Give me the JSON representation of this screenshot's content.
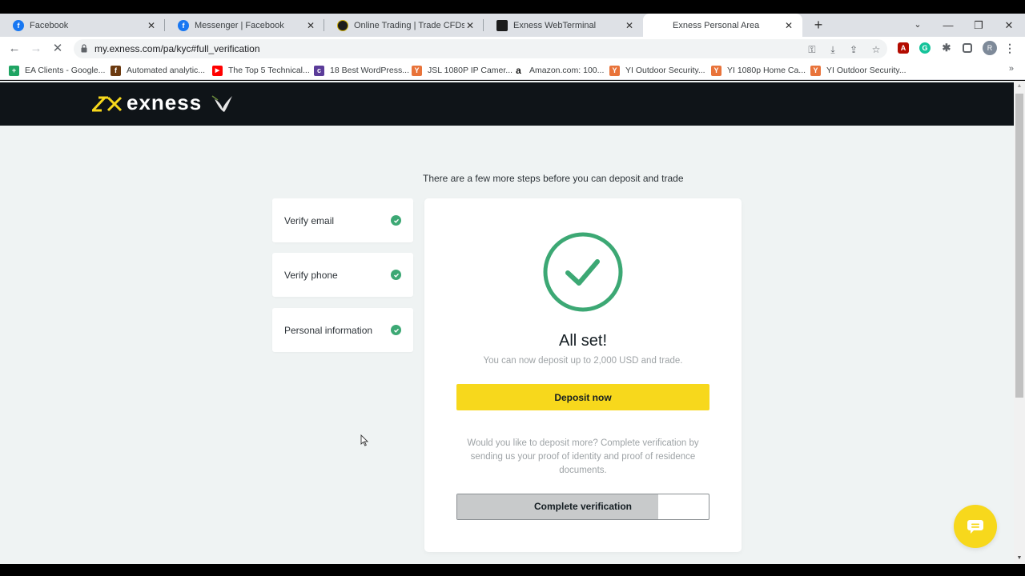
{
  "browser": {
    "tabs": [
      {
        "title": "Facebook",
        "favicon": "facebook-icon",
        "active": false
      },
      {
        "title": "Messenger | Facebook",
        "favicon": "facebook-icon",
        "active": false
      },
      {
        "title": "Online Trading | Trade CFDs on C",
        "favicon": "exness-icon",
        "active": false
      },
      {
        "title": "Exness WebTerminal",
        "favicon": "exness-terminal-icon",
        "active": false
      },
      {
        "title": "Exness Personal Area",
        "favicon": "loading-icon",
        "active": true
      }
    ],
    "close_glyph": "✕",
    "new_tab_glyph": "+",
    "window_controls": {
      "tab_search": "⌄",
      "minimize": "—",
      "restore": "❐",
      "close": "✕"
    },
    "address_bar": {
      "url": "my.exness.com/pa/kyc#full_verification"
    },
    "nav": {
      "back": "←",
      "forward": "→",
      "stop": "✕"
    },
    "profile_initial": "R",
    "bookmarks": [
      {
        "label": "EA Clients - Google...",
        "icon": "google-sheets-icon",
        "color": "#1fa463",
        "glyph": "+"
      },
      {
        "label": "Automated analytic...",
        "icon": "fx-icon",
        "color": "#6b3a10",
        "glyph": "f"
      },
      {
        "label": "The Top 5 Technical...",
        "icon": "youtube-icon",
        "color": "#ff0000",
        "glyph": "▶"
      },
      {
        "label": "18 Best WordPress...",
        "icon": "colorlib-icon",
        "color": "#5b3c99",
        "glyph": "c"
      },
      {
        "label": "JSL 1080P IP Camer...",
        "icon": "yi-icon",
        "color": "#e8733a",
        "glyph": "Y"
      },
      {
        "label": "Amazon.com: 100...",
        "icon": "amazon-icon",
        "color": "#ffffff",
        "glyph": "a"
      },
      {
        "label": "YI Outdoor Security...",
        "icon": "yi-icon",
        "color": "#e8733a",
        "glyph": "Y"
      },
      {
        "label": "YI 1080p Home Ca...",
        "icon": "yi-icon",
        "color": "#e8733a",
        "glyph": "Y"
      },
      {
        "label": "YI Outdoor Security...",
        "icon": "yi-icon",
        "color": "#e8733a",
        "glyph": "Y"
      }
    ],
    "bookmarks_overflow": "»"
  },
  "site": {
    "brand": "exness",
    "subtitle": "There are a few more steps before you can deposit and trade",
    "steps": [
      {
        "label": "Verify email",
        "status": "complete"
      },
      {
        "label": "Verify phone",
        "status": "complete"
      },
      {
        "label": "Personal information",
        "status": "complete"
      }
    ],
    "card": {
      "title": "All set!",
      "message": "You can now deposit up to 2,000 USD and trade.",
      "deposit_button": "Deposit now",
      "more_text": "Would you like to deposit more? Complete verification by sending us your proof of identity and proof of residence documents.",
      "complete_button": "Complete verification",
      "complete_button_progress": 0.8
    }
  },
  "colors": {
    "accent_yellow": "#f7d81c",
    "success_green": "#3ca874",
    "header_dark": "#0f1418",
    "page_bg": "#eff3f3"
  }
}
